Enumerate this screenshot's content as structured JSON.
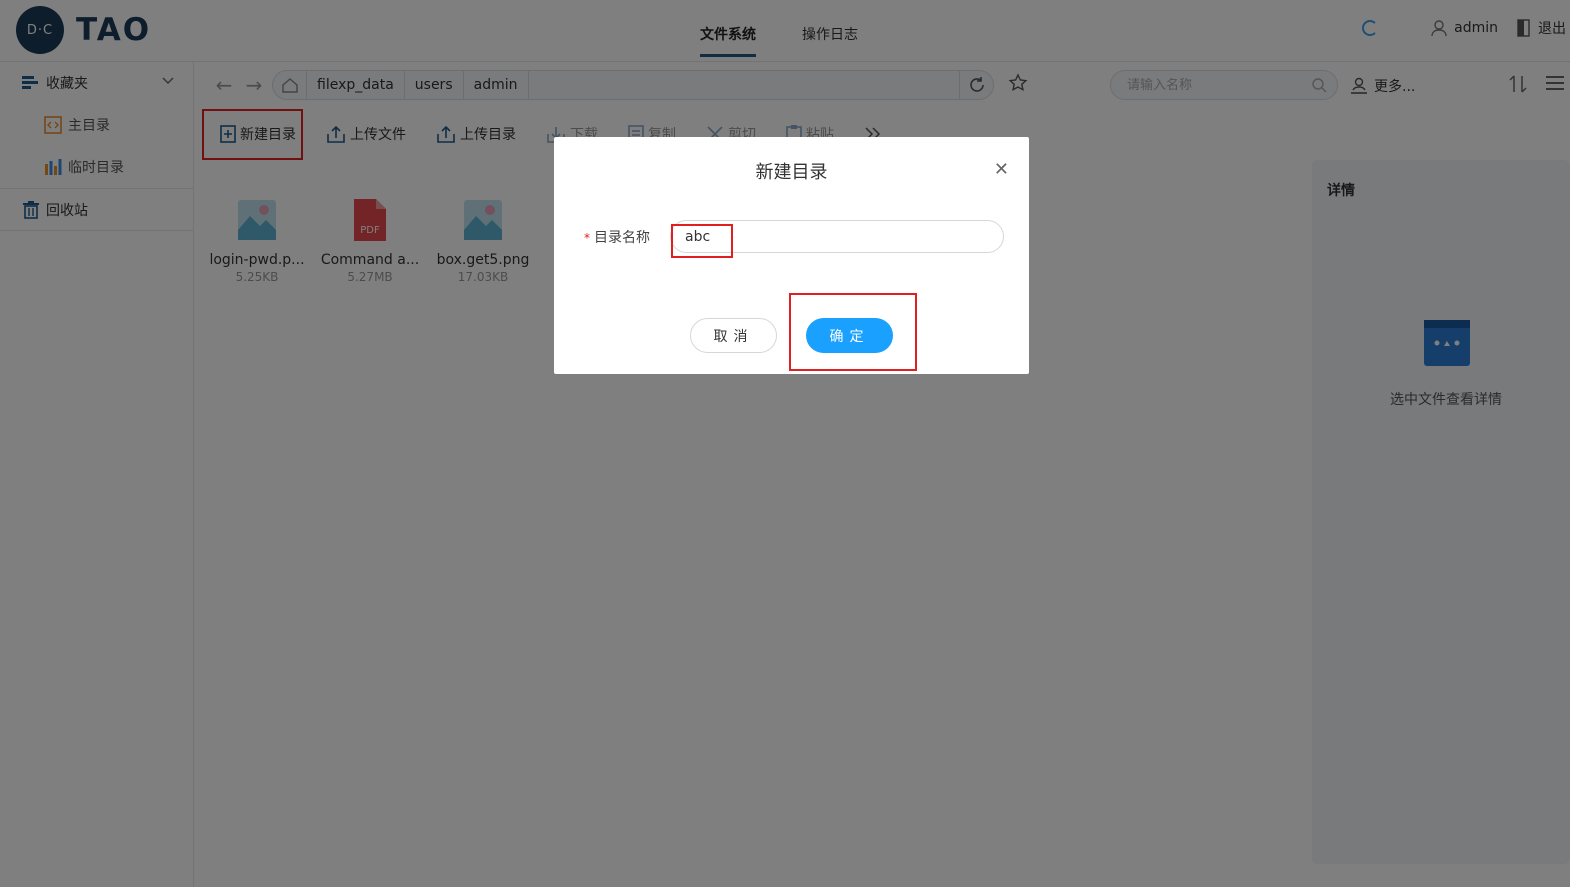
{
  "app": {
    "logo_mark": "D·C",
    "logo_text": "TAO"
  },
  "header": {
    "tabs": [
      {
        "label": "文件系统",
        "active": true
      },
      {
        "label": "操作日志",
        "active": false
      }
    ],
    "user_label": "admin",
    "logout_label": "退出"
  },
  "sidebar": {
    "favorites_label": "收藏夹",
    "items": [
      {
        "label": "主目录",
        "icon": "home-dir-icon"
      },
      {
        "label": "临时目录",
        "icon": "chart-bars-icon"
      }
    ],
    "recycle_label": "回收站"
  },
  "pathbar": {
    "crumbs": [
      "filexp_data",
      "users",
      "admin"
    ],
    "search_placeholder": "请输入名称",
    "more_label": "更多..."
  },
  "actions": [
    {
      "label": "新建目录",
      "muted": false
    },
    {
      "label": "上传文件",
      "muted": false
    },
    {
      "label": "上传目录",
      "muted": false
    },
    {
      "label": "下载",
      "muted": true
    },
    {
      "label": "复制",
      "muted": true
    },
    {
      "label": "剪切",
      "muted": true
    },
    {
      "label": "粘贴",
      "muted": true
    }
  ],
  "files": [
    {
      "name": "login-pwd.p...",
      "size": "5.25KB",
      "type": "image"
    },
    {
      "name": "Command a...",
      "size": "5.27MB",
      "type": "pdf"
    },
    {
      "name": "box.get5.png",
      "size": "17.03KB",
      "type": "image"
    }
  ],
  "detail": {
    "title": "详情",
    "empty_text": "选中文件查看详情"
  },
  "dialog": {
    "title": "新建目录",
    "field_label": "目录名称",
    "field_value": "abc",
    "cancel_label": "取消",
    "ok_label": "确定"
  },
  "colors": {
    "brand": "#1c3a57",
    "primary": "#1aa0ff",
    "highlight": "#e02020"
  }
}
